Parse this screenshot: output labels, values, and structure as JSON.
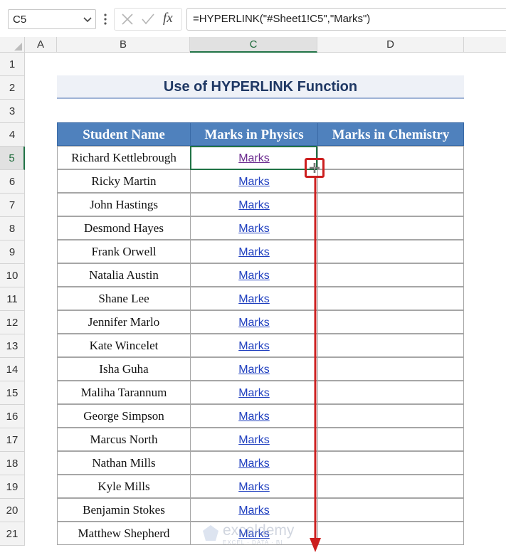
{
  "formula_bar": {
    "name_box": "C5",
    "formula": "=HYPERLINK(\"#Sheet1!C5\",\"Marks\")",
    "fx_label": "fx"
  },
  "columns": [
    "A",
    "B",
    "C",
    "D"
  ],
  "rows": [
    "1",
    "2",
    "3",
    "4",
    "5",
    "6",
    "7",
    "8",
    "9",
    "10",
    "11",
    "12",
    "13",
    "14",
    "15",
    "16",
    "17",
    "18",
    "19",
    "20",
    "21"
  ],
  "title": "Use of HYPERLINK Function",
  "table": {
    "headers": [
      "Student Name",
      "Marks in Physics",
      "Marks in Chemistry"
    ],
    "link_label": "Marks",
    "students": [
      "Richard Kettlebrough",
      "Ricky Martin",
      "John Hastings",
      "Desmond Hayes",
      "Frank Orwell",
      "Natalia Austin",
      "Shane Lee",
      "Jennifer Marlo",
      "Kate Wincelet",
      "Isha Guha",
      "Maliha Tarannum",
      "George Simpson",
      "Marcus North",
      "Nathan Mills",
      "Kyle Mills",
      "Benjamin Stokes",
      "Matthew Shepherd"
    ]
  },
  "selection": {
    "active_column": "C",
    "active_row": "5"
  },
  "colors": {
    "header_fill": "#4f81bd",
    "accent_green": "#217346",
    "highlight_red": "#cc1f1f",
    "link_blue": "#1f3fbf",
    "link_visited": "#6b2b8f"
  },
  "watermark": {
    "name": "exceldemy",
    "tagline": "EXCEL · DATA · BI"
  }
}
